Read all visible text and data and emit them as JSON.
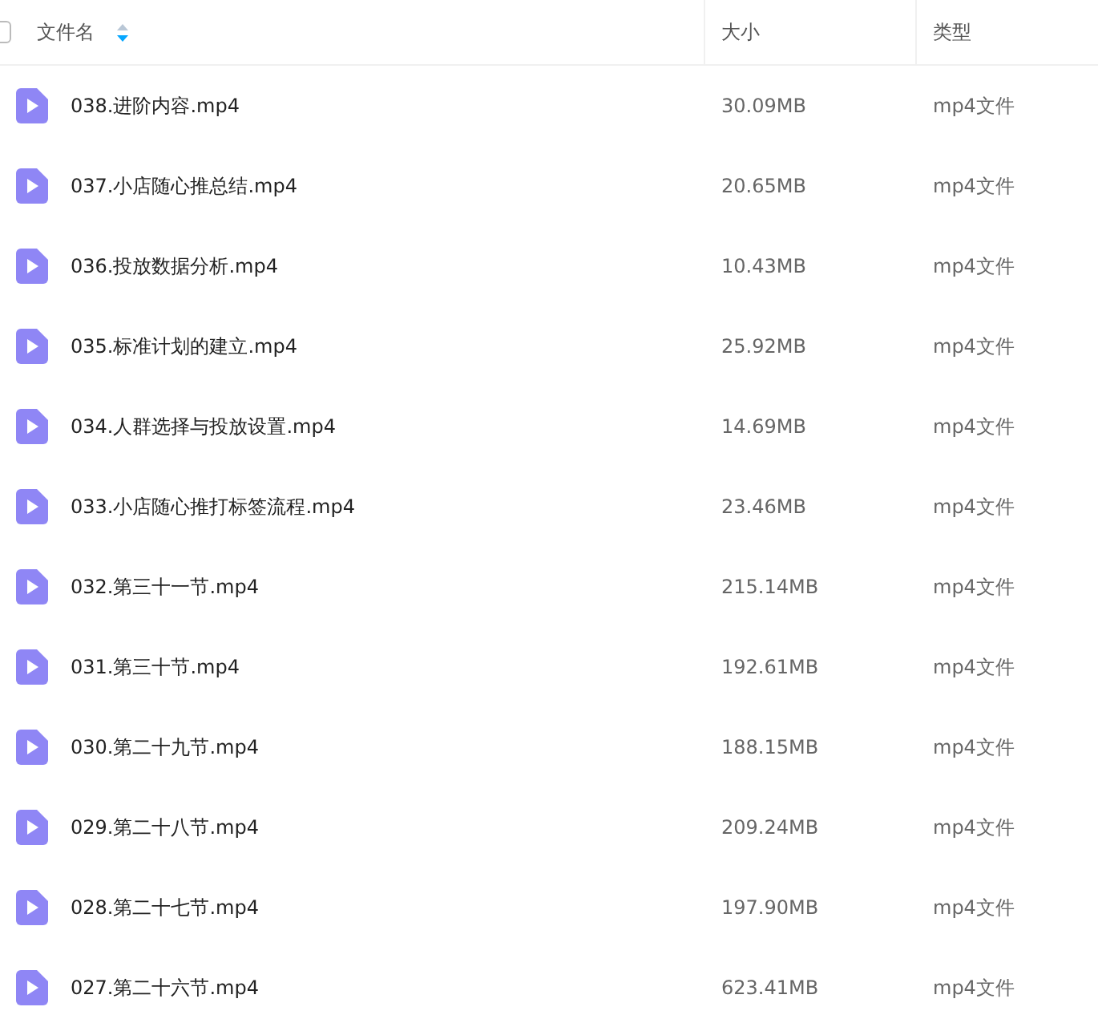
{
  "table": {
    "header_checkbox": {
      "checked": false
    },
    "columns": [
      {
        "label": "文件名",
        "sortable": true
      },
      {
        "label": "大小",
        "sortable": false
      },
      {
        "label": "类型",
        "sortable": false
      }
    ],
    "rows": [
      {
        "name": "038.进阶内容.mp4",
        "size": "30.09MB",
        "type": "mp4文件"
      },
      {
        "name": "037.小店随心推总结.mp4",
        "size": "20.65MB",
        "type": "mp4文件"
      },
      {
        "name": "036.投放数据分析.mp4",
        "size": "10.43MB",
        "type": "mp4文件"
      },
      {
        "name": "035.标准计划的建立.mp4",
        "size": "25.92MB",
        "type": "mp4文件"
      },
      {
        "name": "034.人群选择与投放设置.mp4",
        "size": "14.69MB",
        "type": "mp4文件"
      },
      {
        "name": "033.小店随心推打标签流程.mp4",
        "size": "23.46MB",
        "type": "mp4文件"
      },
      {
        "name": "032.第三十一节.mp4",
        "size": "215.14MB",
        "type": "mp4文件"
      },
      {
        "name": "031.第三十节.mp4",
        "size": "192.61MB",
        "type": "mp4文件"
      },
      {
        "name": "030.第二十九节.mp4",
        "size": "188.15MB",
        "type": "mp4文件"
      },
      {
        "name": "029.第二十八节.mp4",
        "size": "209.24MB",
        "type": "mp4文件"
      },
      {
        "name": "028.第二十七节.mp4",
        "size": "197.90MB",
        "type": "mp4文件"
      },
      {
        "name": "027.第二十六节.mp4",
        "size": "623.41MB",
        "type": "mp4文件"
      }
    ]
  }
}
